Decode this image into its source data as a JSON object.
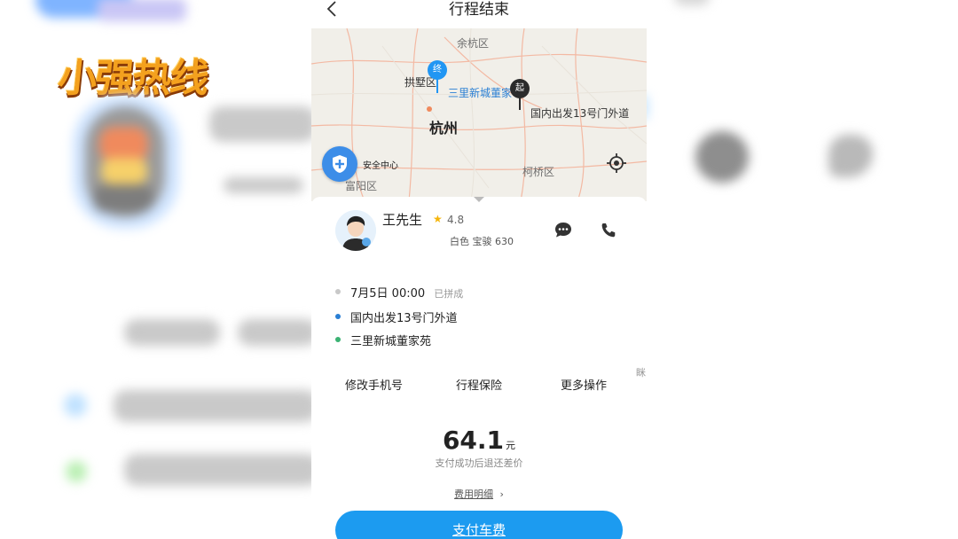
{
  "background": {
    "logo_text": "小强热线"
  },
  "header": {
    "title": "行程结束"
  },
  "map": {
    "labels": {
      "yuhang": "余杭区",
      "gongshu": "拱墅区",
      "sanli": "三里新城董家",
      "hangzhou": "杭州",
      "guonei": "国内出发13号门外道",
      "keqiao": "柯桥区",
      "fuyang": "富阳区"
    },
    "pin_end": "终",
    "pin_start": "起",
    "safety_label": "安全中心"
  },
  "driver": {
    "name": "王先生",
    "rating": "4.8",
    "car": "白色 宝骏 630"
  },
  "trip": {
    "time": "7月5日 00:00",
    "tag": "已拼成",
    "origin": "国内出发13号门外道",
    "destination": "三里新城董家苑"
  },
  "actions": {
    "change_phone": "修改手机号",
    "insurance": "行程保险",
    "more": "更多操作",
    "side_char": "眯"
  },
  "payment": {
    "amount": "64.1",
    "currency": "元",
    "note": "支付成功后退还差价",
    "fee_detail": "费用明细",
    "pay_button": "支付车费"
  },
  "colors": {
    "accent": "#1c9bf0",
    "star": "#f5b50a",
    "origin_dot": "#2a7fd4",
    "destination_dot": "#3bb273"
  }
}
